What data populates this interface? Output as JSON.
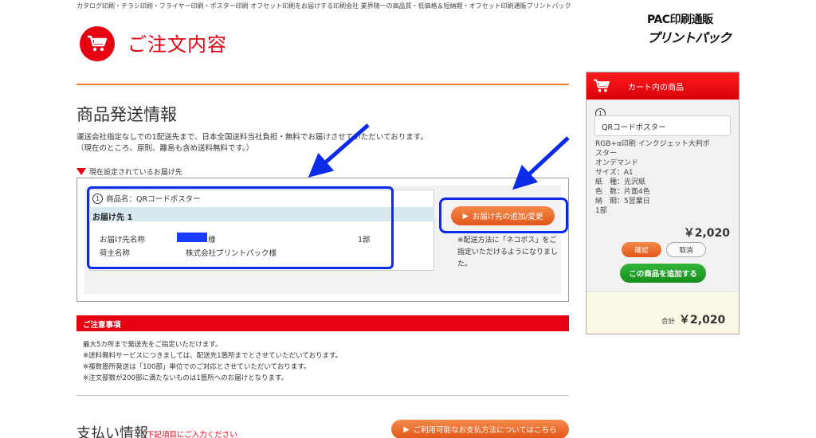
{
  "header": {
    "tagline": "カタログ印刷・チラシ印刷・フライヤー印刷・ポスター印刷 オフセット印刷をお届けする印刷会社 業界随一の高品質・低価格＆短納期・オフセット印刷通販プリントパック",
    "page_title": "ご注文内容",
    "logo_top": "PAC印刷通販",
    "logo_bottom": "プリントパック"
  },
  "shipping": {
    "section_title": "商品発送情報",
    "desc_line1": "運送会社指定なしでの1配送先まで、日本全国送料当社負担・無料でお届けさせていただいております。",
    "desc_line2": "（現在のところ、原則、離島も含め送料無料です。）",
    "current_label": "現在設定されているお届け先",
    "product_number": "1",
    "product_line": "商品名：QRコードポスター",
    "dest_header": "お届け先 1",
    "recipient_label": "お届け先名称",
    "recipient_suffix": "様",
    "quantity": "1部",
    "shipper_label": "荷主名称",
    "shipper_value": "株式会社プリントパック様",
    "change_button": "お届け先の追加/変更",
    "side_note": "※配送方法に「ネコポス」をご指定いただけるようになりました。"
  },
  "notice": {
    "title": "ご注意事項",
    "items": [
      "最大5カ所まで発送先をご指定いただけます。",
      "※送料無料サービスにつきましては、配送先1箇所までとさせていただいております。",
      "※複数箇所発送は「100部」単位でのご対応とさせていただいております。",
      "※注文部数が200部に満たないものは1箇所へのお届けとなります。"
    ]
  },
  "payment": {
    "title": "支払い情報",
    "note": "下記項目にご入力ください",
    "methods_button": "ご利用可能なお支払方法についてはこちら"
  },
  "cart": {
    "header": "カート内の商品",
    "item_number": "1",
    "item_name": "QRコードポスター",
    "specs": [
      "RGB+α印刷 インクジェット大判ポ",
      "スター",
      "オンデマンド",
      "サイズ：A1",
      "紙　種：光沢紙",
      "色　数：片面4色",
      "納　期：5営業日",
      "1部"
    ],
    "price": "￥2,020",
    "confirm_button": "確認",
    "cancel_button": "取消",
    "add_button": "この商品を追加する",
    "total_label": "合計",
    "total_value": "￥2,020"
  },
  "colors": {
    "brand_red": "#e60012",
    "accent_orange": "#f07a2c",
    "annotation_blue": "#0a2be8",
    "add_green": "#1fa326"
  }
}
